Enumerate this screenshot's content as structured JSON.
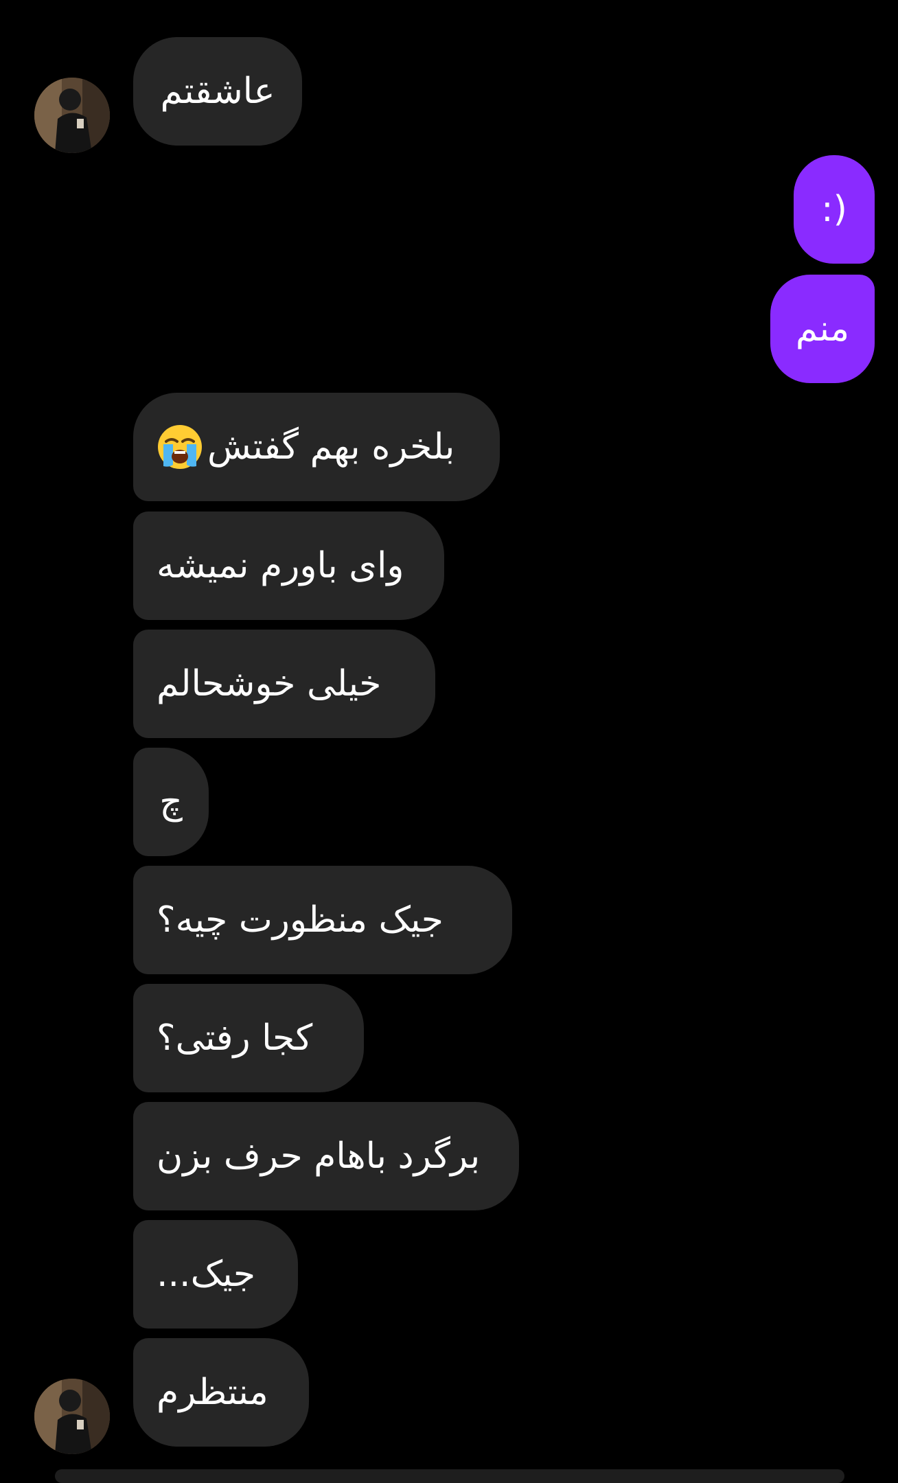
{
  "messages": {
    "m1": "عاشقتم",
    "m2": ":)",
    "m3": "منم",
    "m4": "بلخره بهم گفتش",
    "m4_emoji": "loudly-crying-face-emoji",
    "m5": "وای باورم نمیشه",
    "m6": "خیلی خوشحالم",
    "m7": "چ",
    "m8": "جیک منظورت چیه؟",
    "m9": "کجا رفتی؟",
    "m10": "برگرد باهام حرف بزن",
    "m11": "جیک...",
    "m12": "منتظرم"
  },
  "colors": {
    "background": "#000000",
    "incoming_bubble": "#262626",
    "outgoing_bubble": "#8a2bff",
    "text": "#ffffff"
  }
}
